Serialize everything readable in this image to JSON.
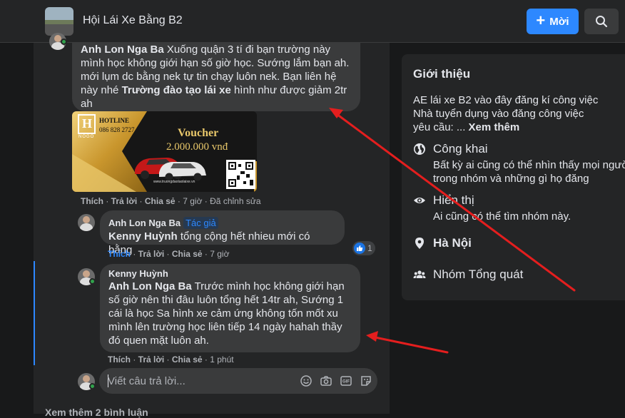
{
  "header": {
    "group_name": "Hội Lái Xe Bằng B2",
    "invite_label": "Mời"
  },
  "comment1": {
    "author": "Anh Lon Nga Ba",
    "line1": "Xuống quận 3 tí đi bạn trường này",
    "line2": "mình học không giới hạn số giờ học. Sướng lắm bạn ah.",
    "line3": "mới lụm dc bằng nek tự tin chạy luôn nek. Bạn liên hệ",
    "line4_prefix": "này nhé",
    "line4_bold": "Trường đào tạo lái xe",
    "line4_suffix": "hình như được giảm 2tr",
    "line5": "ah"
  },
  "voucher": {
    "brand": "H",
    "brand_sub": "NOGO",
    "hotline_label": "HOTLINE",
    "hotline_number": "086 828 2727",
    "title": "Voucher",
    "amount": "2.000.000 vnđ",
    "site": "www.truongdaotaolaixe.vn"
  },
  "actions1": {
    "like": "Thích",
    "reply": "Trả lời",
    "share": "Chia sẻ",
    "time": "7 giờ",
    "edited": "Đã chỉnh sửa"
  },
  "reply1": {
    "author": "Anh Lon Nga Ba",
    "tag": "Tác giả",
    "mention": "Kenny Huỳnh",
    "text": "tổng cộng hết nhieu mới có bằng",
    "reaction_count": "1",
    "like": "Thích",
    "reply": "Trả lời",
    "share": "Chia sẻ",
    "time": "7 giờ"
  },
  "reply2": {
    "author": "Kenny Huỳnh",
    "mention": "Anh Lon Nga Ba",
    "line1": "Trước mình học không giới hạn",
    "line2": "số giờ nên thi đâu luôn tổng hết 14tr ah, Sướng 1",
    "line3": "cái là học Sa hình xe cảm ứng không tốn mốt xu",
    "line4": "mình lên trường học liên tiếp 14 ngày hahah thầy",
    "line5": "đó quen mặt luôn ah.",
    "like": "Thích",
    "reply": "Trả lời",
    "share": "Chia sẻ",
    "time": "1 phút"
  },
  "reply_input": {
    "placeholder": "Viết câu trả lời..."
  },
  "more_comments": "Xem thêm 2 bình luận",
  "about": {
    "title": "Giới thiệu",
    "desc_line1": "AE lái xe B2 vào đây đăng kí công việc",
    "desc_line2": "Nhà tuyển dụng vào đăng công việc",
    "desc_line3_prefix": "yêu cầu: ...",
    "see_more": "Xem thêm",
    "public_title": "Công khai",
    "public_sub_line1": "Bất kỳ ai cũng có thể nhìn thấy mọi người",
    "public_sub_line2": "trong nhóm và những gì họ đăng",
    "visible_title": "Hiển thị",
    "visible_sub": "Ai cũng có thể tìm nhóm này.",
    "location": "Hà Nội",
    "category": "Nhóm Tổng quát"
  },
  "colors": {
    "accent": "#2d88ff",
    "arrow": "#e41e1e",
    "background": "#18191a",
    "surface": "#242526",
    "bubble": "#3a3b3c"
  }
}
